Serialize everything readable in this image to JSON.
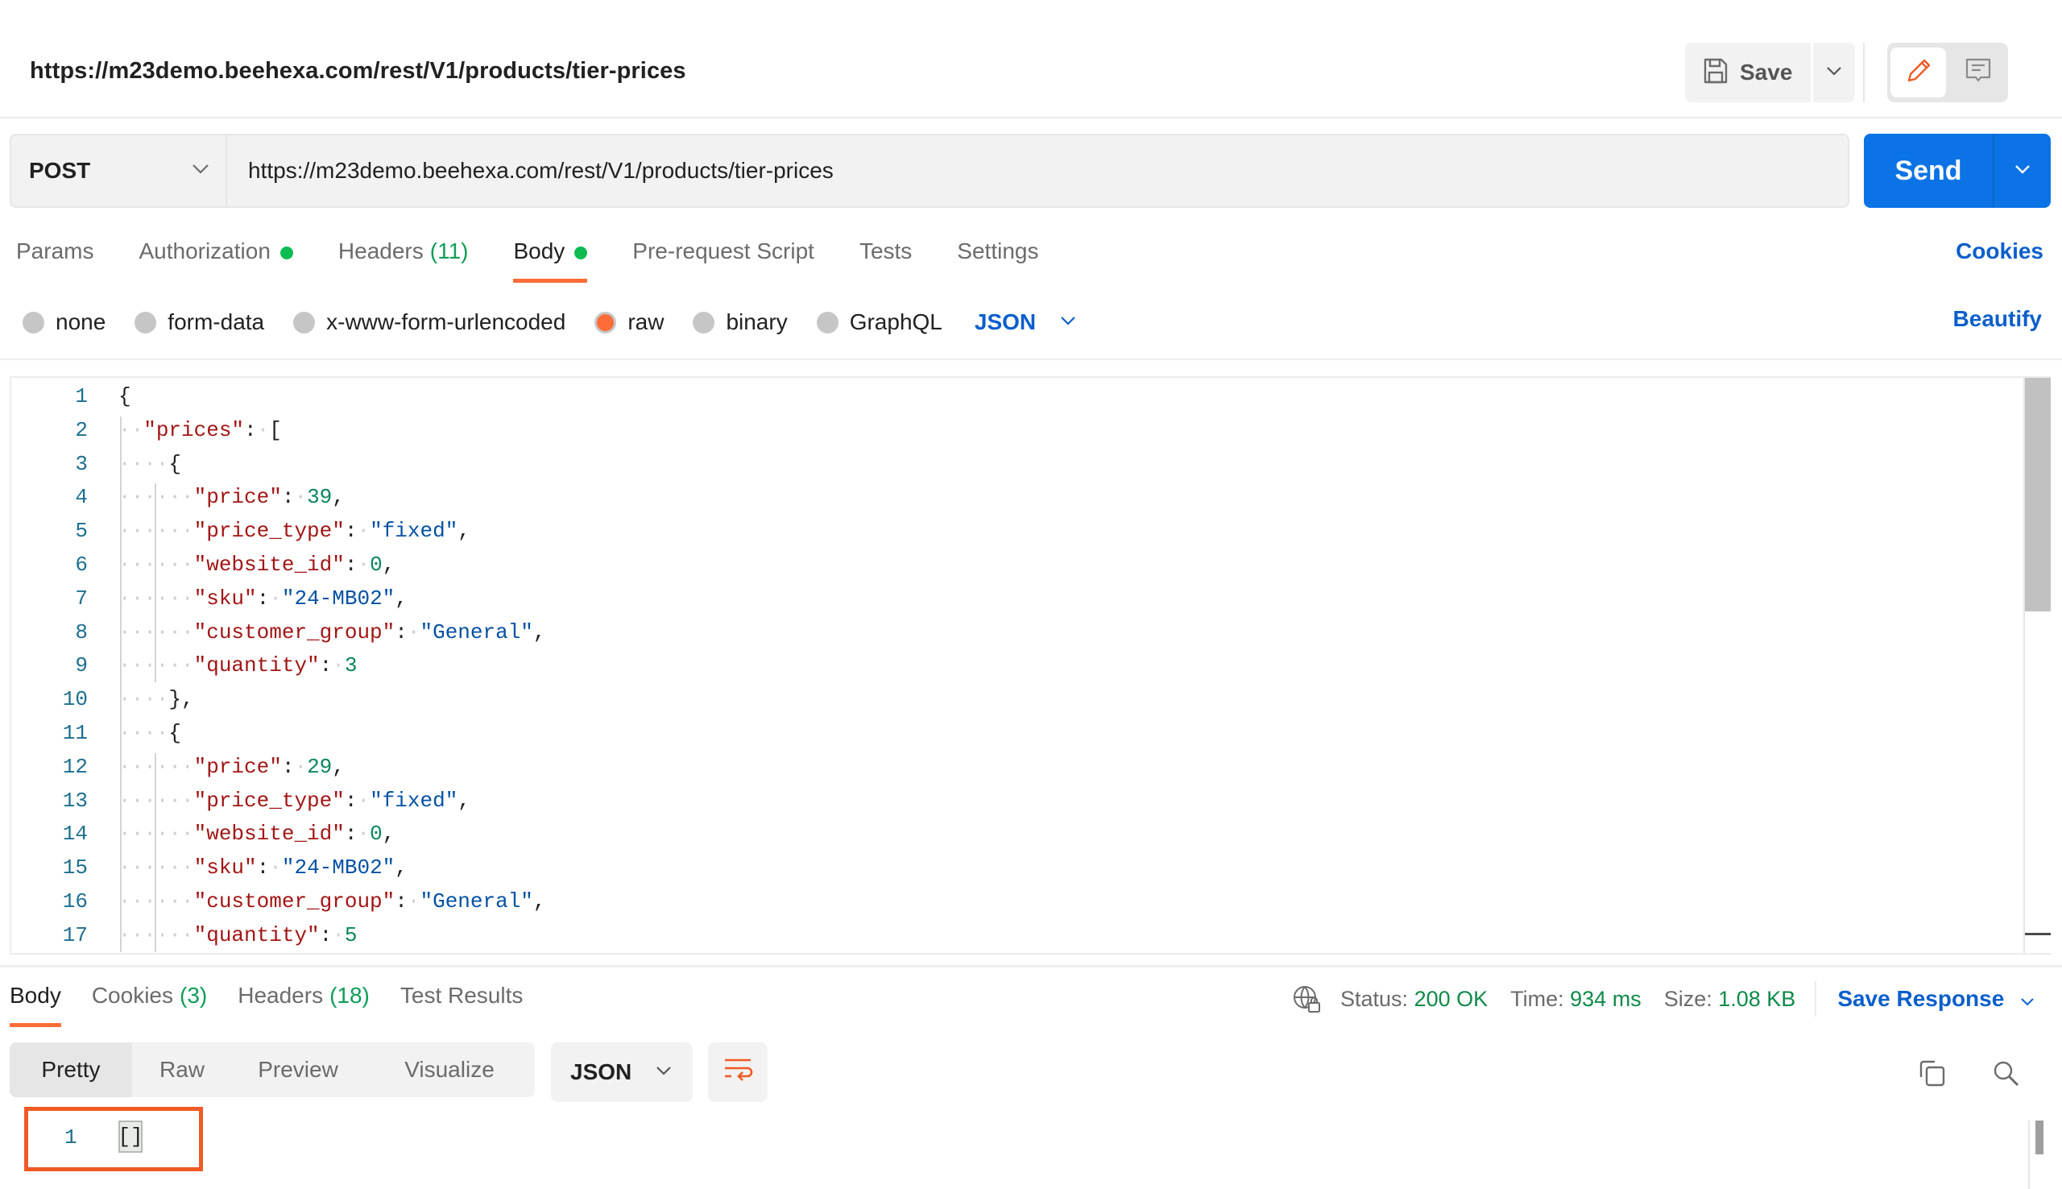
{
  "header": {
    "title": "https://m23demo.beehexa.com/rest/V1/products/tier-prices",
    "save_label": "Save",
    "icons": {
      "save": "floppy-disk-icon",
      "save_menu": "chevron-down-icon",
      "edit_mode": "pencil-icon",
      "docs_mode": "comment-icon"
    }
  },
  "request": {
    "method": "POST",
    "url": "https://m23demo.beehexa.com/rest/V1/products/tier-prices",
    "send_label": "Send",
    "tabs": [
      {
        "label": "Params",
        "count": "",
        "dot": false,
        "active": false
      },
      {
        "label": "Authorization",
        "count": "",
        "dot": true,
        "active": false
      },
      {
        "label": "Headers",
        "count": "(11)",
        "dot": false,
        "active": false
      },
      {
        "label": "Body",
        "count": "",
        "dot": true,
        "active": true
      },
      {
        "label": "Pre-request Script",
        "count": "",
        "dot": false,
        "active": false
      },
      {
        "label": "Tests",
        "count": "",
        "dot": false,
        "active": false
      },
      {
        "label": "Settings",
        "count": "",
        "dot": false,
        "active": false
      }
    ],
    "cookies_label": "Cookies",
    "body_types": [
      {
        "label": "none",
        "selected": false
      },
      {
        "label": "form-data",
        "selected": false
      },
      {
        "label": "x-www-form-urlencoded",
        "selected": false
      },
      {
        "label": "raw",
        "selected": true
      },
      {
        "label": "binary",
        "selected": false
      },
      {
        "label": "GraphQL",
        "selected": false
      }
    ],
    "raw_language": "JSON",
    "beautify_label": "Beautify"
  },
  "editor": {
    "lines": [
      {
        "n": "1",
        "indent": 0,
        "tokens": [
          [
            "p",
            "{"
          ]
        ]
      },
      {
        "n": "2",
        "indent": 1,
        "tokens": [
          [
            "k",
            "\"prices\""
          ],
          [
            "p",
            ":"
          ],
          [
            "ws",
            "·"
          ],
          [
            "p",
            "["
          ]
        ]
      },
      {
        "n": "3",
        "indent": 2,
        "tokens": [
          [
            "p",
            "{"
          ]
        ]
      },
      {
        "n": "4",
        "indent": 3,
        "tokens": [
          [
            "k",
            "\"price\""
          ],
          [
            "p",
            ":"
          ],
          [
            "ws",
            "·"
          ],
          [
            "n",
            "39"
          ],
          [
            "p",
            ","
          ]
        ]
      },
      {
        "n": "5",
        "indent": 3,
        "tokens": [
          [
            "k",
            "\"price_type\""
          ],
          [
            "p",
            ":"
          ],
          [
            "ws",
            "·"
          ],
          [
            "s",
            "\"fixed\""
          ],
          [
            "p",
            ","
          ]
        ]
      },
      {
        "n": "6",
        "indent": 3,
        "tokens": [
          [
            "k",
            "\"website_id\""
          ],
          [
            "p",
            ":"
          ],
          [
            "ws",
            "·"
          ],
          [
            "n",
            "0"
          ],
          [
            "p",
            ","
          ]
        ]
      },
      {
        "n": "7",
        "indent": 3,
        "tokens": [
          [
            "k",
            "\"sku\""
          ],
          [
            "p",
            ":"
          ],
          [
            "ws",
            "·"
          ],
          [
            "s",
            "\"24-MB02\""
          ],
          [
            "p",
            ","
          ]
        ]
      },
      {
        "n": "8",
        "indent": 3,
        "tokens": [
          [
            "k",
            "\"customer_group\""
          ],
          [
            "p",
            ":"
          ],
          [
            "ws",
            "·"
          ],
          [
            "s",
            "\"General\""
          ],
          [
            "p",
            ","
          ]
        ]
      },
      {
        "n": "9",
        "indent": 3,
        "tokens": [
          [
            "k",
            "\"quantity\""
          ],
          [
            "p",
            ":"
          ],
          [
            "ws",
            "·"
          ],
          [
            "n",
            "3"
          ]
        ]
      },
      {
        "n": "10",
        "indent": 2,
        "tokens": [
          [
            "p",
            "},"
          ]
        ]
      },
      {
        "n": "11",
        "indent": 2,
        "tokens": [
          [
            "p",
            "{"
          ]
        ]
      },
      {
        "n": "12",
        "indent": 3,
        "tokens": [
          [
            "k",
            "\"price\""
          ],
          [
            "p",
            ":"
          ],
          [
            "ws",
            "·"
          ],
          [
            "n",
            "29"
          ],
          [
            "p",
            ","
          ]
        ]
      },
      {
        "n": "13",
        "indent": 3,
        "tokens": [
          [
            "k",
            "\"price_type\""
          ],
          [
            "p",
            ":"
          ],
          [
            "ws",
            "·"
          ],
          [
            "s",
            "\"fixed\""
          ],
          [
            "p",
            ","
          ]
        ]
      },
      {
        "n": "14",
        "indent": 3,
        "tokens": [
          [
            "k",
            "\"website_id\""
          ],
          [
            "p",
            ":"
          ],
          [
            "ws",
            "·"
          ],
          [
            "n",
            "0"
          ],
          [
            "p",
            ","
          ]
        ]
      },
      {
        "n": "15",
        "indent": 3,
        "tokens": [
          [
            "k",
            "\"sku\""
          ],
          [
            "p",
            ":"
          ],
          [
            "ws",
            "·"
          ],
          [
            "s",
            "\"24-MB02\""
          ],
          [
            "p",
            ","
          ]
        ]
      },
      {
        "n": "16",
        "indent": 3,
        "tokens": [
          [
            "k",
            "\"customer_group\""
          ],
          [
            "p",
            ":"
          ],
          [
            "ws",
            "·"
          ],
          [
            "s",
            "\"General\""
          ],
          [
            "p",
            ","
          ]
        ]
      },
      {
        "n": "17",
        "indent": 3,
        "tokens": [
          [
            "k",
            "\"quantity\""
          ],
          [
            "p",
            ":"
          ],
          [
            "ws",
            "·"
          ],
          [
            "n",
            "5"
          ]
        ]
      }
    ]
  },
  "response": {
    "tabs": [
      {
        "label": "Body",
        "count": "",
        "active": true
      },
      {
        "label": "Cookies",
        "count": "(3)",
        "active": false
      },
      {
        "label": "Headers",
        "count": "(18)",
        "active": false
      },
      {
        "label": "Test Results",
        "count": "",
        "active": false
      }
    ],
    "status_label": "Status:",
    "status_value": "200 OK",
    "time_label": "Time:",
    "time_value": "934 ms",
    "size_label": "Size:",
    "size_value": "1.08 KB",
    "save_response_label": "Save Response",
    "view_modes": [
      {
        "label": "Pretty",
        "active": true
      },
      {
        "label": "Raw",
        "active": false
      },
      {
        "label": "Preview",
        "active": false
      },
      {
        "label": "Visualize",
        "active": false
      }
    ],
    "format": "JSON",
    "body_line_number": "1",
    "body_value": "[]"
  },
  "colors": {
    "accent_orange": "#ff6c37",
    "send_blue": "#0b73e6",
    "link_blue": "#0b5fcc",
    "status_green": "#0f8a4a",
    "highlight_box": "#f05a24"
  }
}
